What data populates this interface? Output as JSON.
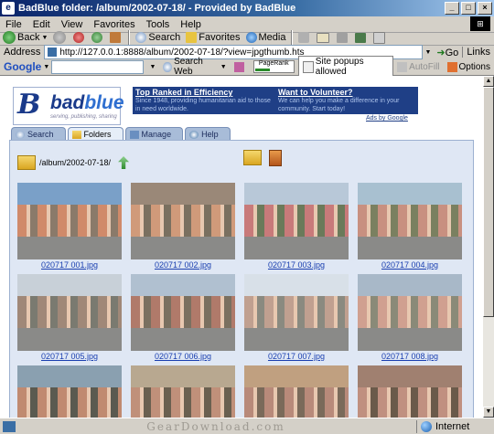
{
  "window": {
    "title": "BadBlue folder: /album/2002-07-18/ - Provided by BadBlue"
  },
  "menu": [
    "File",
    "Edit",
    "View",
    "Favorites",
    "Tools",
    "Help"
  ],
  "toolbar": {
    "back": "Back",
    "search": "Search",
    "favorites": "Favorites",
    "media": "Media"
  },
  "address": {
    "label": "Address",
    "url": "http://127.0.0.1:8888/album/2002-07-18/?view=jpgthumb.hts",
    "go": "Go",
    "links": "Links"
  },
  "googlebar": {
    "logo": "Google",
    "search_web": "Search Web",
    "pagerank": "PageRank",
    "pagerank_level": 0.35,
    "popups": "Site popups allowed",
    "autofill": "AutoFill",
    "options": "Options"
  },
  "brand": {
    "name_a": "bad",
    "name_b": "blue",
    "tagline": "serving, publishing, sharing"
  },
  "ads": [
    {
      "title": "Top Ranked in Efficiency",
      "text": "Since 1948, providing humanitarian aid to those in need worldwide."
    },
    {
      "title": "Want to Volunteer?",
      "text": "We can help you make a difference in your community. Start today!"
    }
  ],
  "ads_by": "Ads by Google",
  "tabs": [
    "Search",
    "Folders",
    "Manage",
    "Help"
  ],
  "folder": {
    "path": "/album/2002-07-18/"
  },
  "photos": [
    {
      "caption": "020717 001.jpg"
    },
    {
      "caption": "020717 002.jpg"
    },
    {
      "caption": "020717 003.jpg"
    },
    {
      "caption": "020717 004.jpg"
    },
    {
      "caption": "020717 005.jpg"
    },
    {
      "caption": "020717 006.jpg"
    },
    {
      "caption": "020717 007.jpg"
    },
    {
      "caption": "020717 008.jpg"
    },
    {
      "caption": ""
    },
    {
      "caption": ""
    },
    {
      "caption": ""
    },
    {
      "caption": ""
    }
  ],
  "status": {
    "watermark": "GearDownload.com",
    "zone": "Internet"
  }
}
